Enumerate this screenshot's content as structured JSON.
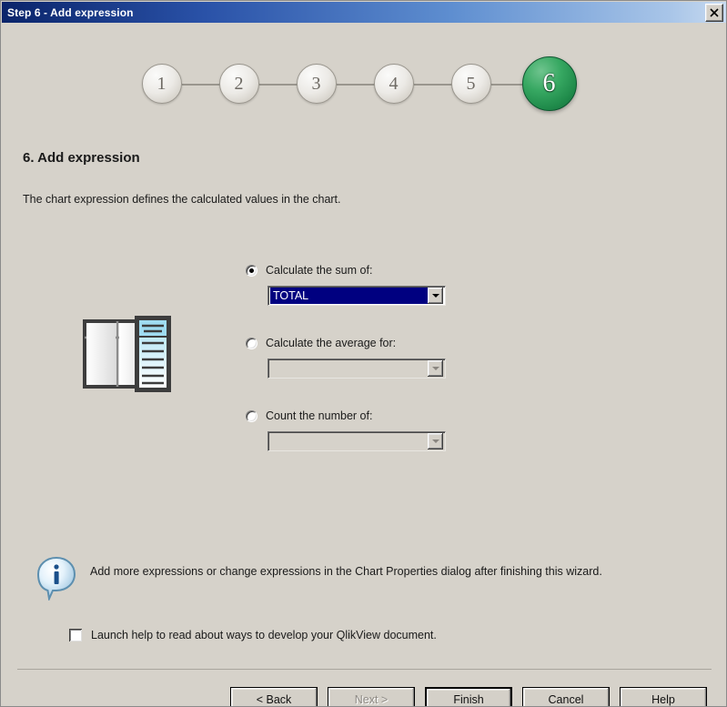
{
  "window": {
    "title": "Step 6 - Add expression",
    "close_icon": "close-icon"
  },
  "stepper": {
    "steps": [
      {
        "label": "1",
        "active": false
      },
      {
        "label": "2",
        "active": false
      },
      {
        "label": "3",
        "active": false
      },
      {
        "label": "4",
        "active": false
      },
      {
        "label": "5",
        "active": false
      },
      {
        "label": "6",
        "active": true
      }
    ],
    "active_color": "#1f8a4a",
    "inactive_color": "#d4d0c8"
  },
  "content": {
    "heading": "6. Add expression",
    "description": "The chart expression defines the calculated values in the chart.",
    "illustration_name": "chart-table-illustration"
  },
  "options": [
    {
      "label": "Calculate the sum of:",
      "checked": true,
      "enabled": true,
      "combo_value": "TOTAL",
      "combo_selected": true
    },
    {
      "label": "Calculate the average for:",
      "checked": false,
      "enabled": false,
      "combo_value": "",
      "combo_selected": false
    },
    {
      "label": "Count the number of:",
      "checked": false,
      "enabled": false,
      "combo_value": "",
      "combo_selected": false
    }
  ],
  "info": {
    "icon": "info-balloon-icon",
    "text": "Add more expressions or change expressions in the Chart Properties dialog after finishing this wizard."
  },
  "launch_help": {
    "label": "Launch help to read about ways to develop your QlikView document.",
    "checked": false
  },
  "footer": {
    "back": "< Back",
    "next": "Next >",
    "finish": "Finish",
    "cancel": "Cancel",
    "help": "Help"
  },
  "colors": {
    "dialog_bg": "#d6d2ca",
    "title_gradient_start": "#0a246a",
    "title_gradient_end": "#c8daf0",
    "selection_blue": "#000080",
    "active_step_green": "#1f8a4a"
  }
}
